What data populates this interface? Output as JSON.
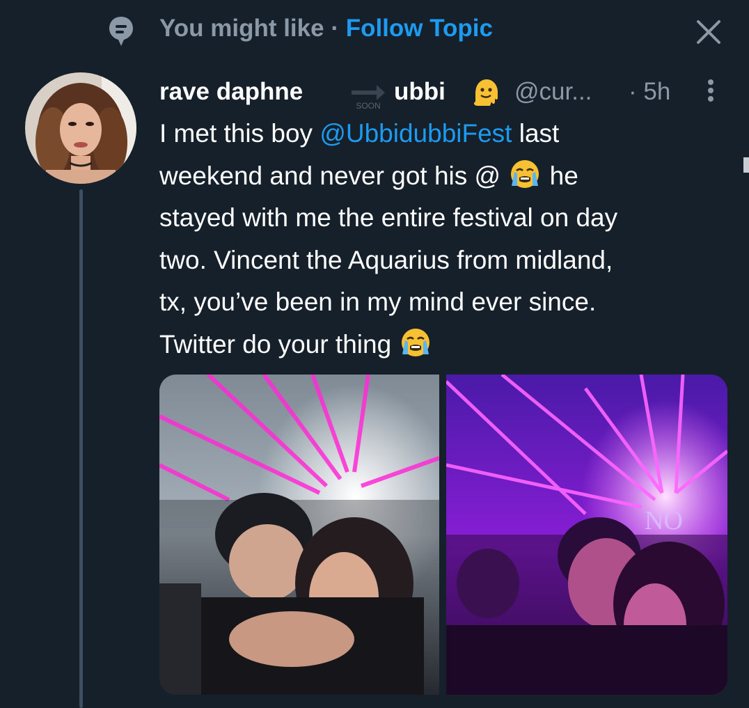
{
  "topic": {
    "prefix": "You might like · ",
    "follow_label": "Follow Topic",
    "icon": "topic-icon",
    "close_icon": "close-icon"
  },
  "tweet": {
    "display_name": "rave daphne",
    "name_badge_text": "SOON",
    "display_name_suffix": "ubbi",
    "name_emoji": "melting-face",
    "handle": "@cur...",
    "time": "· 5h",
    "lines": {
      "l1_before": "I met this boy ",
      "l1_mention": "@UbbidubbiFest",
      "l1_after": " last",
      "l2_before": "weekend and never got his @ ",
      "l2_after": " he",
      "l3": "stayed with me the entire festival on day",
      "l4": "two. Vincent the Aquarius from midland,",
      "l5": "tx, you’ve been in my mind ever since.",
      "l6": "Twitter do your thing "
    },
    "emoji": "loudly-crying-face",
    "photo_count": 2,
    "photo2_sign": "NO"
  },
  "colors": {
    "background": "#15202b",
    "accent": "#1d9bf0",
    "secondary_text": "#8b98a5",
    "primary_text": "#ffffff"
  }
}
